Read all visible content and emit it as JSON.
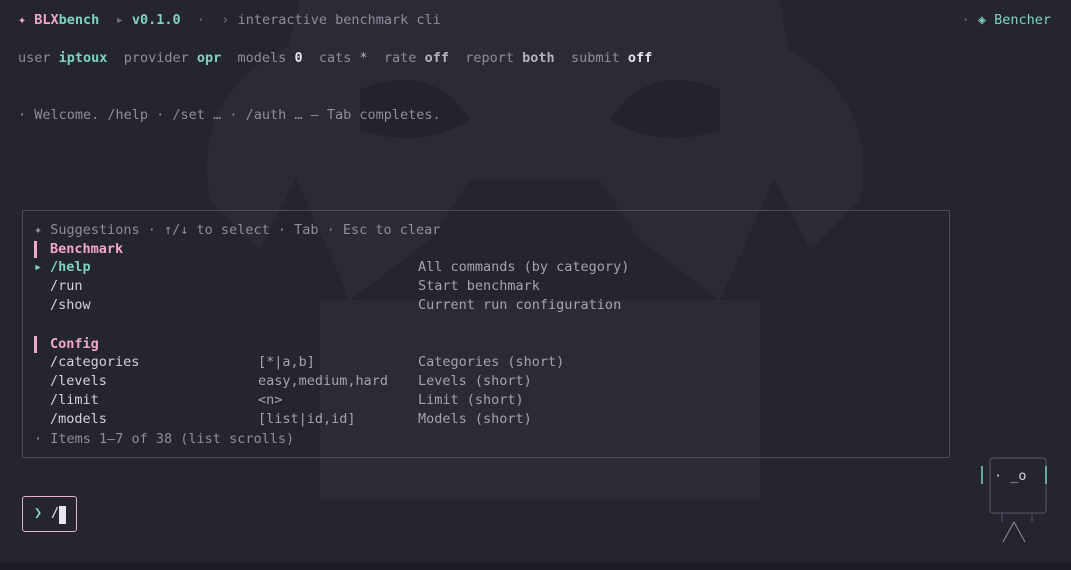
{
  "header": {
    "star_glyph": "✦",
    "brand_part1": "BLX",
    "brand_part2": "bench",
    "triangle": "▸",
    "version": "v0.1.0",
    "dot": "·",
    "chevron": "›",
    "subtitle": "interactive benchmark cli",
    "right_dot": "·",
    "right_glyph": "◈",
    "right_name": "Bencher"
  },
  "status": {
    "user_label": "user",
    "user_value": "iptoux",
    "provider_label": "provider",
    "provider_value": "opr",
    "models_label": "models",
    "models_value": "0",
    "cats_label": "cats",
    "cats_value": "*",
    "rate_label": "rate",
    "rate_value": "off",
    "report_label": "report",
    "report_value": "both",
    "submit_label": "submit",
    "submit_value": "off"
  },
  "welcome": "· Welcome. /help · /set … · /auth … — Tab completes.",
  "suggestions": {
    "header": "✦ Suggestions · ↑/↓ to select · Tab · Esc to clear",
    "pointer": "▸",
    "sections": [
      {
        "title": "Benchmark",
        "items": [
          {
            "cmd": "/help",
            "arg": "",
            "desc": "All commands (by category)"
          },
          {
            "cmd": "/run",
            "arg": "",
            "desc": "Start benchmark"
          },
          {
            "cmd": "/show",
            "arg": "",
            "desc": "Current run configuration"
          }
        ]
      },
      {
        "title": "Config",
        "items": [
          {
            "cmd": "/categories",
            "arg": "[*|a,b]",
            "desc": "Categories (short)"
          },
          {
            "cmd": "/levels",
            "arg": "easy,medium,hard",
            "desc": "Levels (short)"
          },
          {
            "cmd": "/limit",
            "arg": "<n>",
            "desc": "Limit (short)"
          },
          {
            "cmd": "/models",
            "arg": "[list|id,id]",
            "desc": "Models (short)"
          }
        ]
      }
    ],
    "footer": "· Items 1–7 of 38 (list scrolls)"
  },
  "input": {
    "prompt": "❯",
    "value": "/"
  },
  "mascot": {
    "face": "· _o"
  },
  "colors": {
    "background": "#25252f",
    "accent_pink": "#f4a8c8",
    "accent_teal": "#7fd3c0"
  }
}
